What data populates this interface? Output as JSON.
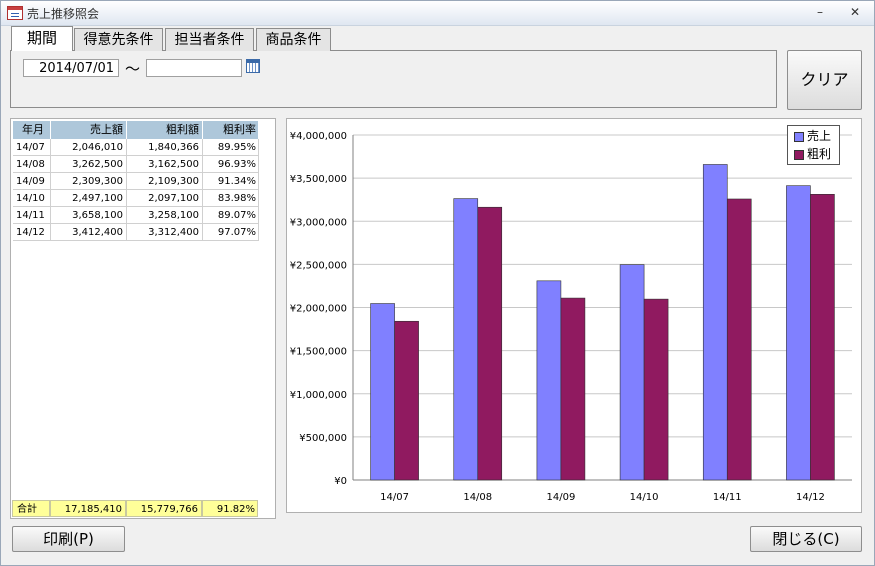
{
  "window": {
    "title": "売上推移照会",
    "minimize_glyph": "–",
    "close_glyph": "✕"
  },
  "tabs": [
    {
      "label": "期間",
      "active": true
    },
    {
      "label": "得意先条件",
      "active": false
    },
    {
      "label": "担当者条件",
      "active": false
    },
    {
      "label": "商品条件",
      "active": false
    }
  ],
  "period": {
    "from": "2014/07/01",
    "separator": "～",
    "to": ""
  },
  "buttons": {
    "clear": "クリア",
    "print": "印刷(P)",
    "close": "閉じる(C)"
  },
  "table": {
    "headers": [
      "年月",
      "売上額",
      "粗利額",
      "粗利率"
    ],
    "rows": [
      [
        "14/07",
        "2,046,010",
        "1,840,366",
        "89.95%"
      ],
      [
        "14/08",
        "3,262,500",
        "3,162,500",
        "96.93%"
      ],
      [
        "14/09",
        "2,309,300",
        "2,109,300",
        "91.34%"
      ],
      [
        "14/10",
        "2,497,100",
        "2,097,100",
        "83.98%"
      ],
      [
        "14/11",
        "3,658,100",
        "3,258,100",
        "89.07%"
      ],
      [
        "14/12",
        "3,412,400",
        "3,312,400",
        "97.07%"
      ]
    ],
    "total": [
      "合計",
      "17,185,410",
      "15,779,766",
      "91.82%"
    ]
  },
  "chart_data": {
    "type": "bar",
    "categories": [
      "14/07",
      "14/08",
      "14/09",
      "14/10",
      "14/11",
      "14/12"
    ],
    "series": [
      {
        "name": "売上",
        "values": [
          2046010,
          3262500,
          2309300,
          2497100,
          3658100,
          3412400
        ],
        "color": "#8080ff"
      },
      {
        "name": "粗利",
        "values": [
          1840366,
          3162500,
          2109300,
          2097100,
          3258100,
          3312400
        ],
        "color": "#901a60"
      }
    ],
    "ylim": [
      0,
      4000000
    ],
    "yticks": [
      0,
      500000,
      1000000,
      1500000,
      2000000,
      2500000,
      3000000,
      3500000,
      4000000
    ],
    "ytick_labels": [
      "¥0",
      "¥500,000",
      "¥1,000,000",
      "¥1,500,000",
      "¥2,000,000",
      "¥2,500,000",
      "¥3,000,000",
      "¥3,500,000",
      "¥4,000,000"
    ],
    "grid": true,
    "legend": "top-right"
  },
  "icons": {
    "app": "form-icon",
    "calendar": "calendar-icon"
  }
}
